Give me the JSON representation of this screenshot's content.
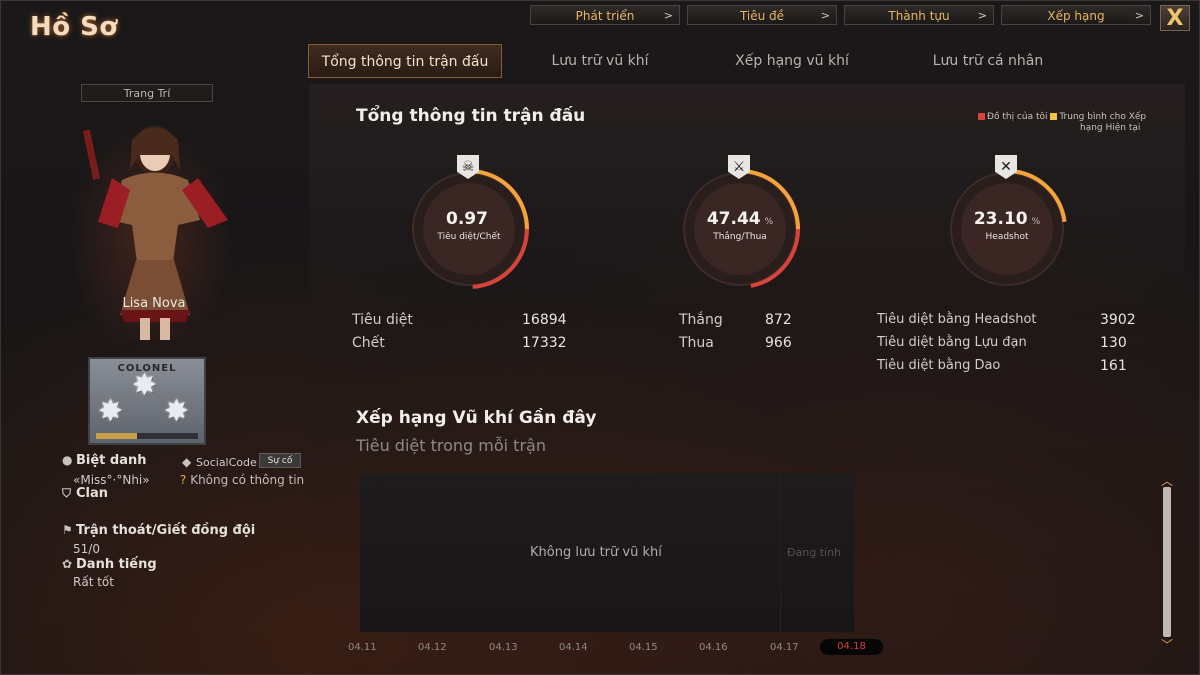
{
  "title": "Hồ Sơ",
  "top_nav": [
    {
      "label": "Phát triển"
    },
    {
      "label": "Tiêu đề"
    },
    {
      "label": "Thành tựu"
    },
    {
      "label": "Xếp hạng"
    }
  ],
  "close_label": "X",
  "tabs": [
    {
      "label": "Tổng thông tin trận đấu",
      "active": true
    },
    {
      "label": "Lưu trữ vũ khí"
    },
    {
      "label": "Xếp hạng vũ khí"
    },
    {
      "label": "Lưu trữ cá nhân"
    }
  ],
  "left": {
    "decor_button": "Trang Trí",
    "character_name": "Lisa Nova",
    "rank_name": "COLONEL",
    "rank_progress": 0.4,
    "nickname_label": "Biệt danh",
    "nickname_value": "«Miss°·°Nhi»",
    "socialcode_label": "SocialCode",
    "socialcode_button": "Sự cố",
    "socialcode_value": "Không có thông tin",
    "clan_label": "Clan",
    "escape_label": "Trận thoát/Giết đồng đội",
    "escape_value": "51/0",
    "reputation_label": "Danh tiếng",
    "reputation_value": "Rất tốt"
  },
  "main": {
    "section_title": "Tổng thông tin trận đấu",
    "legend_mine": "Đồ thị của tôi",
    "legend_avg_line1": "Trung bình cho Xếp",
    "legend_avg_line2": "hạng Hiện tại",
    "gauges": [
      {
        "value": "0.97",
        "pct": "",
        "label": "Tiêu diệt/Chết",
        "icon": "skull-icon",
        "glyph": "☠",
        "fill": 0.49
      },
      {
        "value": "47.44",
        "pct": "%",
        "label": "Thắng/Thua",
        "icon": "crossed-swords-icon",
        "glyph": "⚔",
        "fill": 0.47
      },
      {
        "value": "23.10",
        "pct": "%",
        "label": "Headshot",
        "icon": "crossed-rifles-icon",
        "glyph": "✕",
        "fill": 0.23
      }
    ],
    "stats_kd": [
      {
        "label": "Tiêu diệt",
        "value": "16894"
      },
      {
        "label": "Chết",
        "value": "17332"
      }
    ],
    "stats_wl": [
      {
        "label": "Thắng",
        "value": "872"
      },
      {
        "label": "Thua",
        "value": "966"
      }
    ],
    "stats_hs": [
      {
        "label": "Tiêu diệt bằng Headshot",
        "value": "3902"
      },
      {
        "label": "Tiêu diệt bằng Lựu đạn",
        "value": "130"
      },
      {
        "label": "Tiêu diệt bằng Dao",
        "value": "161"
      }
    ],
    "weapon_title": "Xếp hạng Vũ khí Gần đây",
    "weapon_sub": "Tiêu diệt trong mỗi trận",
    "empty_msg": "Không lưu trữ vũ khí",
    "pending": "Đang tính",
    "dates": [
      "04.11",
      "04.12",
      "04.13",
      "04.14",
      "04.15",
      "04.16",
      "04.17",
      "04.18"
    ],
    "active_date": "04.18"
  },
  "colors": {
    "accent": "#e8b460",
    "gauge_arc": "#d9433a",
    "gauge_arc_avg": "#f2a43a"
  }
}
